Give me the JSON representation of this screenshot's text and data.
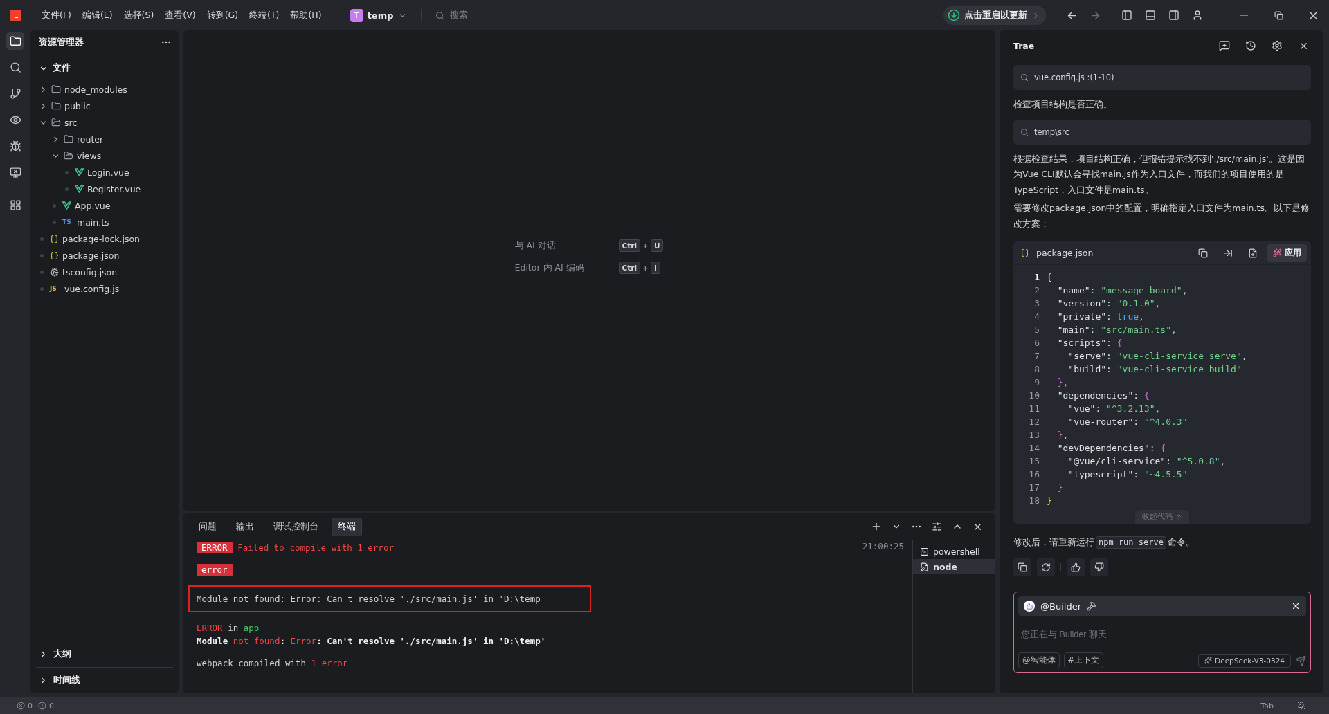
{
  "title_bar": {
    "menu": [
      "文件(F)",
      "编辑(E)",
      "选择(S)",
      "查看(V)",
      "转到(G)",
      "终端(T)",
      "帮助(H)"
    ],
    "project": {
      "initial": "T",
      "name": "temp"
    },
    "search": {
      "placeholder": "搜索"
    },
    "update_button": "点击重启以更新"
  },
  "activity_bar": [
    {
      "kind": "files",
      "selected": true
    },
    {
      "kind": "search",
      "selected": false
    },
    {
      "kind": "branch",
      "selected": false
    },
    {
      "kind": "preview",
      "selected": false
    },
    {
      "kind": "debug",
      "selected": false
    },
    {
      "kind": "remote",
      "selected": false
    },
    {
      "kind": "extensions",
      "selected": false
    }
  ],
  "explorer": {
    "title": "资源管理器",
    "section": {
      "label": "文件",
      "expanded": true
    },
    "tree": [
      {
        "name": "node_modules",
        "kind": "folder",
        "expanded": false
      },
      {
        "name": "public",
        "kind": "folder",
        "expanded": false
      },
      {
        "name": "src",
        "kind": "folder",
        "expanded": true,
        "children": [
          {
            "name": "router",
            "kind": "folder",
            "expanded": false
          },
          {
            "name": "views",
            "kind": "folder",
            "expanded": true,
            "children": [
              {
                "name": "Login.vue",
                "kind": "vue"
              },
              {
                "name": "Register.vue",
                "kind": "vue"
              }
            ]
          },
          {
            "name": "App.vue",
            "kind": "vue"
          },
          {
            "name": "main.ts",
            "kind": "ts",
            "badge": "TS"
          }
        ]
      },
      {
        "name": "package-lock.json",
        "kind": "json"
      },
      {
        "name": "package.json",
        "kind": "json"
      },
      {
        "name": "tsconfig.json",
        "kind": "config"
      },
      {
        "name": "vue.config.js",
        "kind": "js",
        "badge": "JS"
      }
    ],
    "bottom_sections": [
      {
        "label": "大纲",
        "expanded": false
      },
      {
        "label": "时间线",
        "expanded": false
      }
    ]
  },
  "editor": {
    "hints": [
      {
        "label": "与 AI 对话",
        "keys": [
          "Ctrl",
          "+",
          "U"
        ]
      },
      {
        "label": "Editor 内 AI 编码",
        "keys": [
          "Ctrl",
          "+",
          "I"
        ]
      }
    ]
  },
  "panel": {
    "tabs": [
      {
        "label": "问题",
        "selected": false
      },
      {
        "label": "输出",
        "selected": false
      },
      {
        "label": "调试控制台",
        "selected": false
      },
      {
        "label": "终端",
        "selected": true
      }
    ],
    "timestamp": "21:00:25",
    "output": [
      [
        {
          "segments": [
            {
              "kind": "badge",
              "text": "ERROR"
            },
            {
              "kind": "err",
              "text": " Failed to compile with 1 error"
            }
          ],
          "boxed": false
        }
      ],
      [
        {
          "segments": [
            {
              "kind": "badge",
              "text": "error"
            }
          ],
          "boxed": false
        }
      ],
      [
        {
          "segments": [
            {
              "kind": "plain",
              "text": "Module not found: Error: Can't resolve './src/main.js' in 'D:\\temp'"
            }
          ],
          "boxed": true
        }
      ],
      [
        {
          "segments": [
            {
              "kind": "err",
              "text": "ERROR"
            },
            {
              "kind": "plain",
              "text": " in "
            },
            {
              "kind": "ok",
              "text": "app"
            }
          ],
          "boxed": false
        },
        {
          "segments": [
            {
              "kind": "bold",
              "text": "Module "
            },
            {
              "kind": "err",
              "text": "not found"
            },
            {
              "kind": "bold",
              "text": ": "
            },
            {
              "kind": "err",
              "text": "Error"
            },
            {
              "kind": "bold",
              "text": ": Can't resolve './src/main.js' in 'D:\\temp'"
            }
          ],
          "boxed": false
        }
      ],
      [
        {
          "segments": [
            {
              "kind": "plain",
              "text": "webpack compiled with "
            },
            {
              "kind": "err",
              "text": "1 error"
            }
          ],
          "boxed": false
        }
      ]
    ],
    "sessions": [
      {
        "name": "powershell",
        "selected": false
      },
      {
        "name": "node",
        "selected": true
      }
    ]
  },
  "assistant": {
    "title": "Trae",
    "messages": [
      {
        "kind": "ref",
        "text": "vue.config.js :(1-10)"
      },
      {
        "kind": "text",
        "text": "检查项目结构是否正确。"
      },
      {
        "kind": "ref",
        "text": "temp\\src"
      },
      {
        "kind": "text",
        "text": "根据检查结果，项目结构正确，但报错提示找不到'./src/main.js'。这是因为Vue CLI默认会寻找main.js作为入口文件，而我们的项目使用的是TypeScript，入口文件是main.ts。"
      },
      {
        "kind": "text",
        "text": "需要修改package.json中的配置，明确指定入口文件为main.ts。以下是修改方案："
      }
    ],
    "code_block": {
      "file": "package.json",
      "apply": "应用",
      "collapse": "收起代码",
      "lines": [
        {
          "n": "1",
          "current": true,
          "tokens": [
            {
              "kind": "b1",
              "text": "{"
            }
          ]
        },
        {
          "n": "2",
          "current": false,
          "tokens": [
            {
              "kind": "key",
              "text": "  \"name\": "
            },
            {
              "kind": "str",
              "text": "\"message-board\""
            },
            {
              "kind": "p",
              "text": ","
            }
          ]
        },
        {
          "n": "3",
          "current": false,
          "tokens": [
            {
              "kind": "key",
              "text": "  \"version\": "
            },
            {
              "kind": "str",
              "text": "\"0.1.0\""
            },
            {
              "kind": "p",
              "text": ","
            }
          ]
        },
        {
          "n": "4",
          "current": false,
          "tokens": [
            {
              "kind": "key",
              "text": "  \"private\": "
            },
            {
              "kind": "bool",
              "text": "true"
            },
            {
              "kind": "p",
              "text": ","
            }
          ]
        },
        {
          "n": "5",
          "current": false,
          "tokens": [
            {
              "kind": "key",
              "text": "  \"main\": "
            },
            {
              "kind": "str",
              "text": "\"src/main.ts\""
            },
            {
              "kind": "p",
              "text": ","
            }
          ]
        },
        {
          "n": "6",
          "current": false,
          "tokens": [
            {
              "kind": "key",
              "text": "  \"scripts\": "
            },
            {
              "kind": "b2",
              "text": "{"
            }
          ]
        },
        {
          "n": "7",
          "current": false,
          "tokens": [
            {
              "kind": "key",
              "text": "    \"serve\": "
            },
            {
              "kind": "str",
              "text": "\"vue-cli-service serve\""
            },
            {
              "kind": "p",
              "text": ","
            }
          ]
        },
        {
          "n": "8",
          "current": false,
          "tokens": [
            {
              "kind": "key",
              "text": "    \"build\": "
            },
            {
              "kind": "str",
              "text": "\"vue-cli-service build\""
            }
          ]
        },
        {
          "n": "9",
          "current": false,
          "tokens": [
            {
              "kind": "b2",
              "text": "  }"
            },
            {
              "kind": "p",
              "text": ","
            }
          ]
        },
        {
          "n": "10",
          "current": false,
          "tokens": [
            {
              "kind": "key",
              "text": "  \"dependencies\": "
            },
            {
              "kind": "b2",
              "text": "{"
            }
          ]
        },
        {
          "n": "11",
          "current": false,
          "tokens": [
            {
              "kind": "key",
              "text": "    \"vue\": "
            },
            {
              "kind": "str",
              "text": "\"^3.2.13\""
            },
            {
              "kind": "p",
              "text": ","
            }
          ]
        },
        {
          "n": "12",
          "current": false,
          "tokens": [
            {
              "kind": "key",
              "text": "    \"vue-router\": "
            },
            {
              "kind": "str",
              "text": "\"^4.0.3\""
            }
          ]
        },
        {
          "n": "13",
          "current": false,
          "tokens": [
            {
              "kind": "b2",
              "text": "  }"
            },
            {
              "kind": "p",
              "text": ","
            }
          ]
        },
        {
          "n": "14",
          "current": false,
          "tokens": [
            {
              "kind": "key",
              "text": "  \"devDependencies\": "
            },
            {
              "kind": "b2",
              "text": "{"
            }
          ]
        },
        {
          "n": "15",
          "current": false,
          "tokens": [
            {
              "kind": "key",
              "text": "    \"@vue/cli-service\": "
            },
            {
              "kind": "str",
              "text": "\"^5.0.8\""
            },
            {
              "kind": "p",
              "text": ","
            }
          ]
        },
        {
          "n": "16",
          "current": false,
          "tokens": [
            {
              "kind": "key",
              "text": "    \"typescript\": "
            },
            {
              "kind": "str",
              "text": "\"~4.5.5\""
            }
          ]
        },
        {
          "n": "17",
          "current": false,
          "tokens": [
            {
              "kind": "b2",
              "text": "  }"
            }
          ]
        },
        {
          "n": "18",
          "current": false,
          "tokens": [
            {
              "kind": "b1",
              "text": "}"
            }
          ]
        }
      ]
    },
    "closing": {
      "before": "修改后，请重新运行",
      "code": "npm run serve",
      "after": "命令。"
    },
    "composer": {
      "agent": "@Builder",
      "placeholder": "您正在与 Builder 聊天",
      "buttons": [
        "@智能体",
        "#上下文"
      ],
      "model": "DeepSeek-V3-0324"
    }
  },
  "status_bar": {
    "errors": "0",
    "warnings": "0",
    "right": "Tab"
  }
}
